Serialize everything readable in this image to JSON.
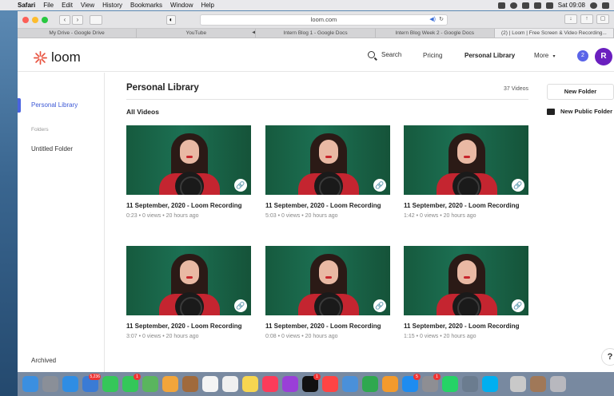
{
  "menubar": {
    "app": "Safari",
    "items": [
      "File",
      "Edit",
      "View",
      "History",
      "Bookmarks",
      "Window",
      "Help"
    ],
    "clock": "Sat 09:08"
  },
  "browser": {
    "url": "loom.com",
    "tabs": [
      {
        "label": "My Drive - Google Drive",
        "active": false
      },
      {
        "label": "YouTube",
        "active": false,
        "audio": true
      },
      {
        "label": "Intern Blog 1 - Google Docs",
        "active": false
      },
      {
        "label": "Intern Blog Week 2 - Google Docs",
        "active": false
      },
      {
        "label": "(2) | Loom | Free Screen & Video Recording...",
        "active": true
      }
    ]
  },
  "nav": {
    "logo": "loom",
    "search": "Search",
    "pricing": "Pricing",
    "personal_library": "Personal Library",
    "more": "More",
    "notif_count": "2",
    "avatar_initial": "R"
  },
  "sidebar": {
    "personal_library": "Personal Library",
    "folders_heading": "Folders",
    "folder_1": "Untitled Folder",
    "archived": "Archived"
  },
  "main": {
    "title": "Personal Library",
    "count": "37 Videos",
    "section": "All Videos",
    "videos": [
      {
        "title": "11 September, 2020 - Loom Recording",
        "meta": "0:23 • 0 views • 20 hours ago"
      },
      {
        "title": "11 September, 2020 - Loom Recording",
        "meta": "5:03 • 0 views • 20 hours ago"
      },
      {
        "title": "11 September, 2020 - Loom Recording",
        "meta": "1:42 • 0 views • 20 hours ago"
      },
      {
        "title": "11 September, 2020 - Loom Recording",
        "meta": "3:07 • 0 views • 20 hours ago"
      },
      {
        "title": "11 September, 2020 - Loom Recording",
        "meta": "0:08 • 0 views • 20 hours ago"
      },
      {
        "title": "11 September, 2020 - Loom Recording",
        "meta": "1:15 • 0 views • 20 hours ago"
      }
    ]
  },
  "right": {
    "new_folder": "New Folder",
    "new_public_folder": "New Public Folder",
    "help": "?"
  },
  "dock": {
    "badges": {
      "mail": "5,236",
      "messages": "1",
      "appstore": "5",
      "settings": "1",
      "news": "1"
    }
  },
  "colors": {
    "accent": "#4a63e0",
    "avatar": "#6a1fbf",
    "badge": "#5a64e8",
    "loom_red": "#e8523f"
  }
}
